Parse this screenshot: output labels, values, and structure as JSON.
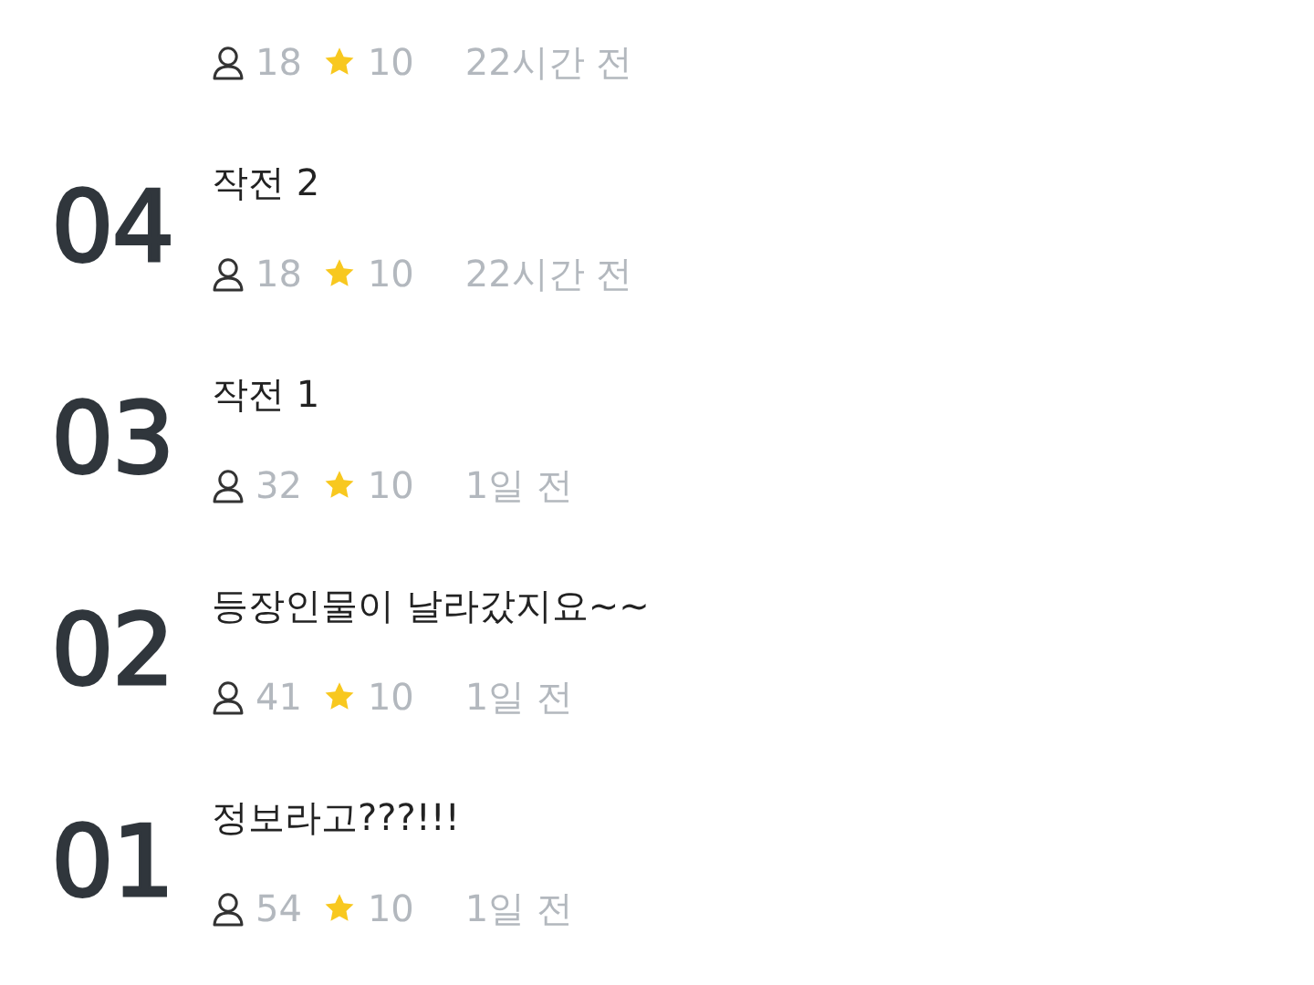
{
  "episodes": [
    {
      "views": "18",
      "rating": "10",
      "time": "22시간 전"
    },
    {
      "number": "04",
      "title": "작전 2",
      "views": "18",
      "rating": "10",
      "time": "22시간 전"
    },
    {
      "number": "03",
      "title": "작전 1",
      "views": "32",
      "rating": "10",
      "time": "1일 전"
    },
    {
      "number": "02",
      "title": "등장인물이 날라갔지요~~",
      "views": "41",
      "rating": "10",
      "time": "1일 전"
    },
    {
      "number": "01",
      "title": "정보라고???!!!",
      "views": "54",
      "rating": "10",
      "time": "1일 전"
    }
  ]
}
